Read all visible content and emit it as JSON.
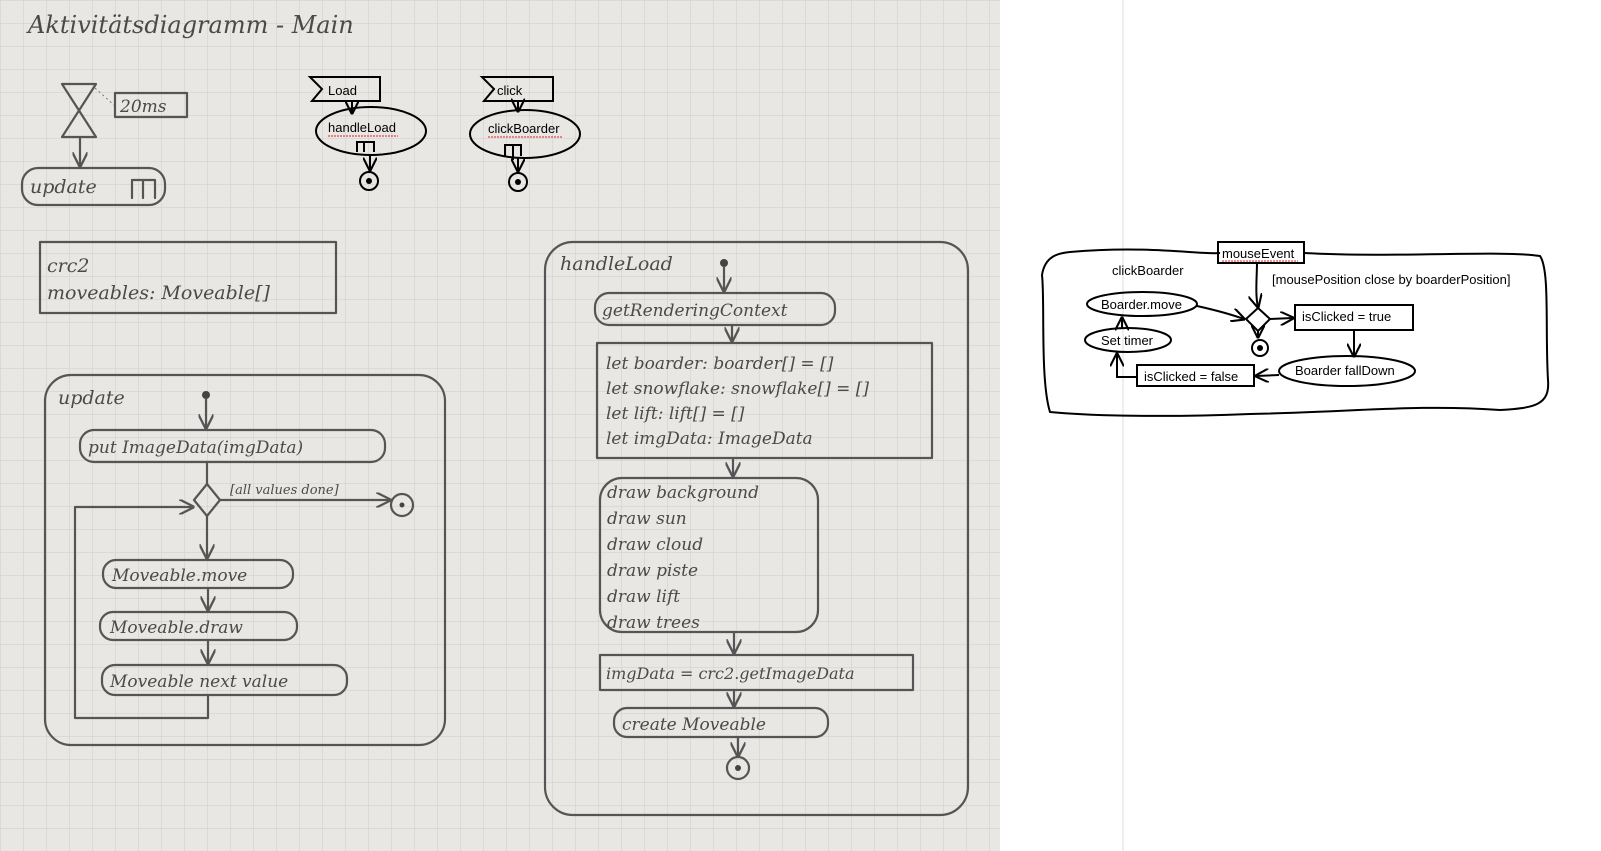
{
  "photo": {
    "title": "Aktivitätsdiagramm - Main",
    "timer": {
      "duration": "20ms",
      "action": "update"
    },
    "load_event": {
      "signal": "Load",
      "action": "handleLoad"
    },
    "click_event": {
      "signal": "click",
      "action": "clickBoarder"
    },
    "globals": {
      "lines": [
        "crc2",
        "moveables: Moveable[]"
      ]
    },
    "update_frame": {
      "label": "update",
      "put_image": "put ImageData(imgData)",
      "guard": "[all values done]",
      "actions": [
        "Moveable.move",
        "Moveable.draw",
        "Moveable next value"
      ]
    },
    "handleload_frame": {
      "label": "handleLoad",
      "get_context": "getRenderingContext",
      "declarations": [
        "let boarder: boarder[] = []",
        "let snowflake: snowflake[] = []",
        "let lift: lift[] = []",
        "let imgData: ImageData"
      ],
      "draws": [
        "draw background",
        "draw sun",
        "draw cloud",
        "draw piste",
        "draw lift",
        "draw trees"
      ],
      "get_image": "imgData = crc2.getImageData",
      "create": "create Moveable"
    }
  },
  "click_diagram": {
    "label": "clickBoarder",
    "event": "mouseEvent",
    "guard": "[mousePosition close by boarderPosition]",
    "boarder_move": "Boarder.move",
    "set_timer": "Set timer",
    "clicked_true": "isClicked = true",
    "clicked_false": "isClicked = false",
    "fall_down": "Boarder fallDown"
  },
  "colors": {
    "paper": "#e9e7e4",
    "pencil": "#555555",
    "ink": "#000000",
    "spellcheck": "#e02020"
  }
}
